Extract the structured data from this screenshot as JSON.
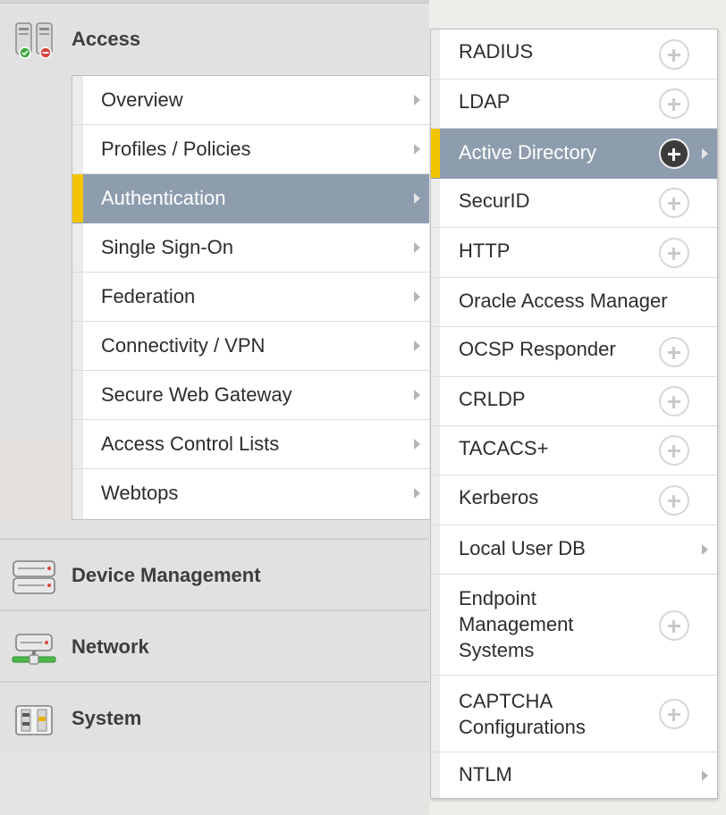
{
  "nav": {
    "access": {
      "label": "Access",
      "icon": "access-icon"
    },
    "device_management": {
      "label": "Device Management",
      "icon": "server-icon"
    },
    "network": {
      "label": "Network",
      "icon": "network-icon"
    },
    "system": {
      "label": "System",
      "icon": "system-icon"
    }
  },
  "access_menu": {
    "items": [
      {
        "label": "Overview",
        "has_submenu": true
      },
      {
        "label": "Profiles / Policies",
        "has_submenu": true
      },
      {
        "label": "Authentication",
        "has_submenu": true,
        "selected": true
      },
      {
        "label": "Single Sign-On",
        "has_submenu": true
      },
      {
        "label": "Federation",
        "has_submenu": true
      },
      {
        "label": "Connectivity / VPN",
        "has_submenu": true
      },
      {
        "label": "Secure Web Gateway",
        "has_submenu": true
      },
      {
        "label": "Access Control Lists",
        "has_submenu": true
      },
      {
        "label": "Webtops",
        "has_submenu": true
      }
    ]
  },
  "authentication_menu": {
    "items": [
      {
        "label": "RADIUS",
        "action": "add"
      },
      {
        "label": "LDAP",
        "action": "add"
      },
      {
        "label": "Active Directory",
        "action": "add",
        "has_submenu": true,
        "selected": true
      },
      {
        "label": "SecurID",
        "action": "add"
      },
      {
        "label": "HTTP",
        "action": "add"
      },
      {
        "label": "Oracle Access Manager",
        "action": "none"
      },
      {
        "label": "OCSP Responder",
        "action": "add"
      },
      {
        "label": "CRLDP",
        "action": "add"
      },
      {
        "label": "TACACS+",
        "action": "add"
      },
      {
        "label": "Kerberos",
        "action": "add"
      },
      {
        "label": "Local User DB",
        "action": "none",
        "has_submenu": true
      },
      {
        "label": "Endpoint Management Systems",
        "lines": [
          "Endpoint",
          "Management",
          "Systems"
        ],
        "action": "add"
      },
      {
        "label": "CAPTCHA Configurations",
        "lines": [
          "CAPTCHA",
          "Configurations"
        ],
        "action": "add"
      },
      {
        "label": "NTLM",
        "action": "none",
        "has_submenu": true
      }
    ]
  },
  "colors": {
    "selected_bg": "#8e9dae",
    "selected_marker": "#f3c500",
    "panel_bg": "#e1e1e1"
  }
}
